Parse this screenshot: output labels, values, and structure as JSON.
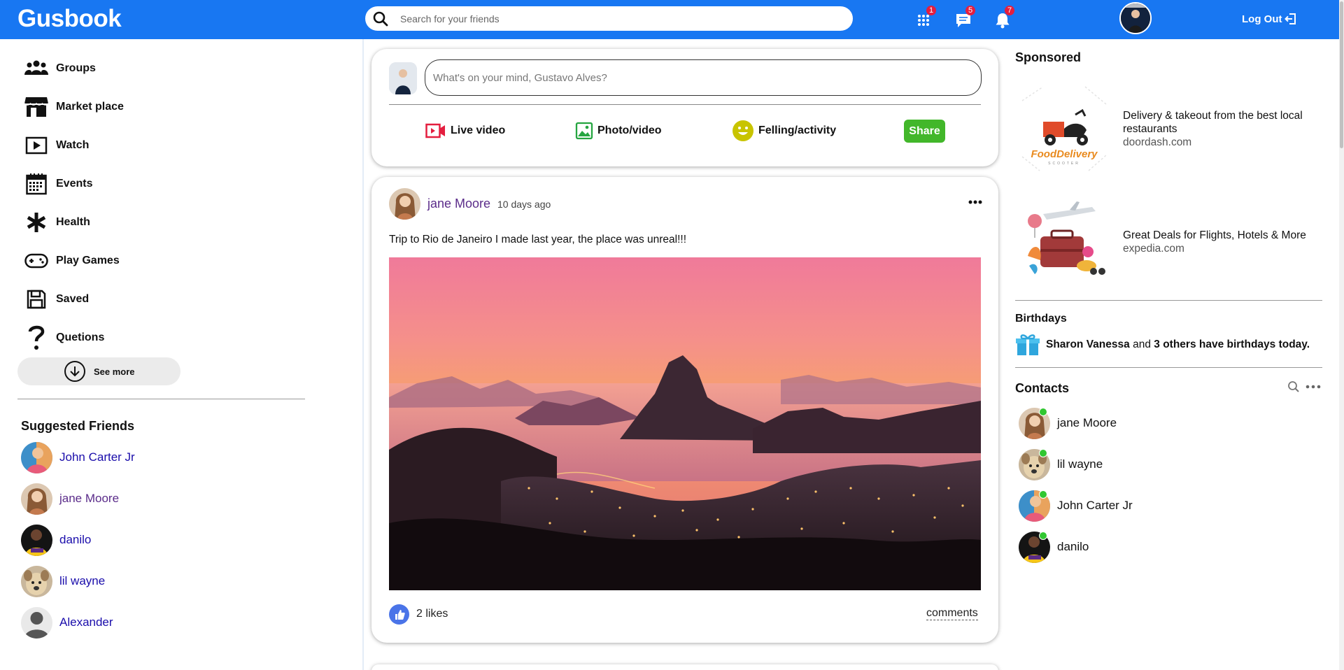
{
  "app": {
    "title": "Gusbook",
    "accent": "#1877f2",
    "online_color": "#31c731",
    "badge_color": "#e41e3f"
  },
  "topbar": {
    "search_placeholder": "Search for your friends",
    "badges": {
      "apps": "1",
      "messages": "5",
      "notifications": "7"
    },
    "logout_label": "Log Out"
  },
  "sidebar": {
    "items": [
      {
        "label": "Groups",
        "icon": "groups-icon"
      },
      {
        "label": "Market place",
        "icon": "store-icon"
      },
      {
        "label": "Watch",
        "icon": "play-icon"
      },
      {
        "label": "Events",
        "icon": "calendar-icon"
      },
      {
        "label": "Health",
        "icon": "asterisk-icon"
      },
      {
        "label": "Play Games",
        "icon": "gamepad-icon"
      },
      {
        "label": "Saved",
        "icon": "floppy-icon"
      },
      {
        "label": "Quetions",
        "icon": "question-icon"
      }
    ],
    "see_more_label": "See more",
    "suggested_title": "Suggested Friends",
    "suggested": [
      {
        "name": "John Carter Jr"
      },
      {
        "name": "jane Moore"
      },
      {
        "name": "danilo"
      },
      {
        "name": "lil wayne"
      },
      {
        "name": "Alexander"
      }
    ]
  },
  "composer": {
    "placeholder": "What's on your mind, Gustavo Alves?",
    "live_label": "Live video",
    "photo_label": "Photo/video",
    "feeling_label": "Felling/activity",
    "share_label": "Share"
  },
  "post": {
    "author": "jane Moore",
    "time": "10 days ago",
    "text": "Trip to Rio de Janeiro I made last year, the place was unreal!!!",
    "likes": "2 likes",
    "comments_label": "comments"
  },
  "right": {
    "sponsored_title": "Sponsored",
    "ads": [
      {
        "logo_text": "FoodDelivery",
        "logo_sub": "SCOOTER",
        "text": "Delivery & takeout from the best local restaurants",
        "domain": "doordash.com"
      },
      {
        "text": "Great Deals for Flights, Hotels & More",
        "domain": "expedia.com"
      }
    ],
    "birthdays_title": "Birthdays",
    "birthday_name": "Sharon Vanessa",
    "birthday_and": "and",
    "birthday_rest": "3 others have birthdays today.",
    "contacts_title": "Contacts",
    "contacts": [
      {
        "name": "jane Moore"
      },
      {
        "name": "lil wayne"
      },
      {
        "name": "John Carter Jr"
      },
      {
        "name": "danilo"
      }
    ]
  }
}
